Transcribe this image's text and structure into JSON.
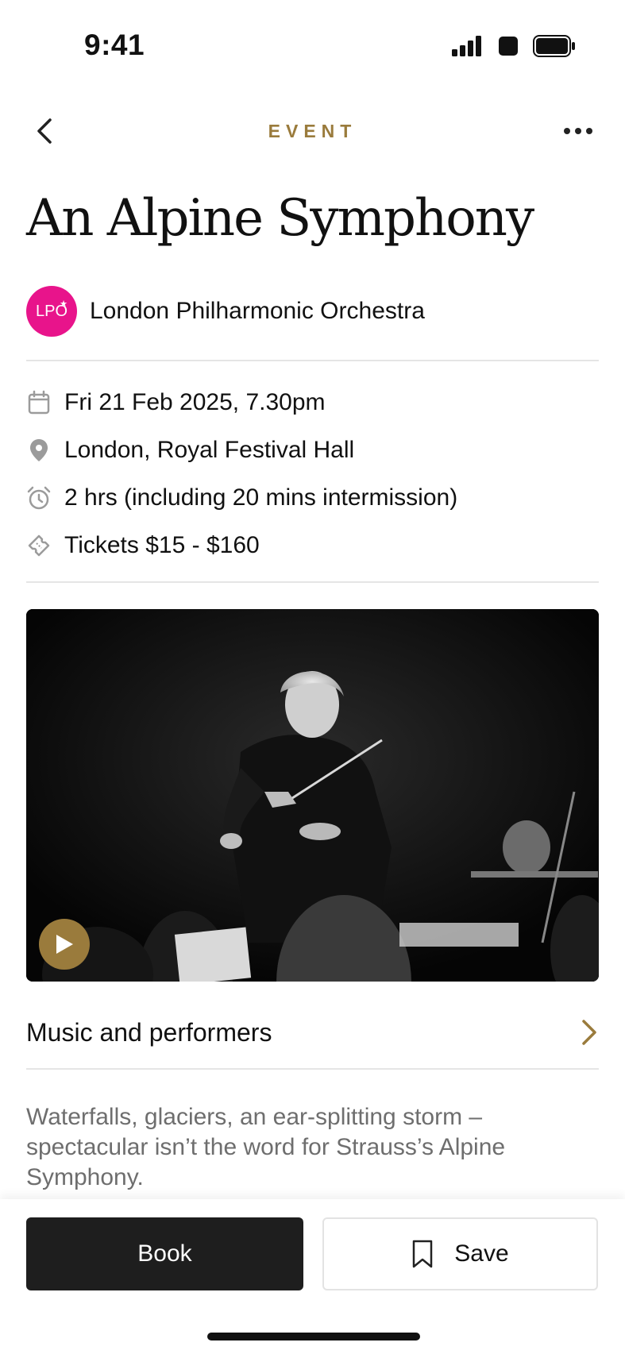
{
  "status_bar": {
    "time": "9:41"
  },
  "nav": {
    "title": "EVENT"
  },
  "event": {
    "title": "An Alpine Symphony",
    "organizer": {
      "logo_text": "LPO",
      "name": "London Philharmonic Orchestra"
    },
    "details": [
      {
        "icon": "calendar-icon",
        "text": "Fri 21 Feb 2025, 7.30pm"
      },
      {
        "icon": "location-pin-icon",
        "text": "London, Royal Festival Hall"
      },
      {
        "icon": "alarm-clock-icon",
        "text": "2 hrs (including 20 mins intermission)"
      },
      {
        "icon": "ticket-icon",
        "text": "Tickets $15 - $160"
      }
    ],
    "media": {
      "type": "video",
      "subject": "conductor-photo"
    },
    "section_link": "Music and performers",
    "description": "Waterfalls, glaciers, an ear-splitting storm – spectacular isn’t the word for Strauss’s Alpine Symphony."
  },
  "actions": {
    "book_label": "Book",
    "save_label": "Save"
  },
  "colors": {
    "accent": "#9A7B3C",
    "brand_pink": "#E8148B",
    "button_dark": "#1E1E1E"
  }
}
